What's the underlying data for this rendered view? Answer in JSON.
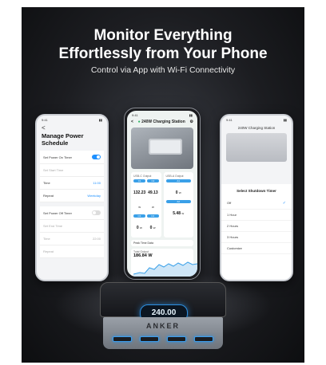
{
  "hero": {
    "title_line1": "Monitor Everything",
    "title_line2": "Effortlessly from Your Phone",
    "subtitle": "Control via App with Wi-Fi Connectivity"
  },
  "left_phone": {
    "time": "9:41",
    "back": "<",
    "title": "Manage Power Schedule",
    "rows": [
      {
        "label": "Set Power On Timer",
        "value": ""
      },
      {
        "label": "Set Start Time",
        "value": ""
      },
      {
        "label": "Time",
        "value": "11:00"
      },
      {
        "label": "Repeat",
        "value": "Weekday"
      },
      {
        "label": "Set Power Off Timer",
        "value": ""
      },
      {
        "label": "Set End Time",
        "value": ""
      },
      {
        "label": "Time",
        "value": "22:00"
      },
      {
        "label": "Repeat",
        "value": ""
      }
    ]
  },
  "center_phone": {
    "time": "9:41",
    "title": "240W Charging Station",
    "usb_c_label": "USB-C Output",
    "usb_a_label": "USB-A Output",
    "ports": [
      {
        "tag": "C1",
        "value": "132.23",
        "unit": "W"
      },
      {
        "tag": "C2",
        "value": "49.13",
        "unit": "W"
      },
      {
        "tag": "A1",
        "value": "0",
        "unit": "W"
      },
      {
        "tag": "C3",
        "value": "0",
        "unit": "W"
      },
      {
        "tag": "C4",
        "value": "0",
        "unit": "W"
      },
      {
        "tag": "A2",
        "value": "5.48",
        "unit": "W"
      }
    ],
    "peak_label": "Peak Time Data",
    "total_label": "Total Output",
    "total_value": "186.84 W"
  },
  "right_phone": {
    "time": "9:41",
    "title": "240W Charging Station",
    "sheet_title": "Select Shutdown Timer",
    "options": [
      "Off",
      "1 Hour",
      "2 Hours",
      "3 Hours",
      "Customize"
    ],
    "selected_index": 0
  },
  "station": {
    "display": "240.00",
    "brand": "ANKER"
  },
  "colors": {
    "accent": "#1e90ff",
    "glow": "#2d8fe0",
    "background": "#1c1d21"
  }
}
